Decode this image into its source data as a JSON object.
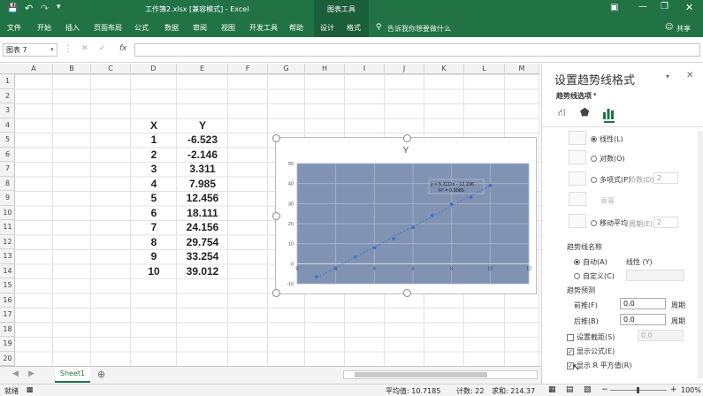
{
  "titlebar": {
    "title": "工作簿2.xlsx [兼容模式] - Excel",
    "context_tools": "图表工具"
  },
  "ribbon": {
    "tabs": [
      "文件",
      "开始",
      "插入",
      "页面布局",
      "公式",
      "数据",
      "审阅",
      "视图",
      "开发工具",
      "帮助",
      "设计",
      "格式"
    ],
    "search_placeholder": "告诉我你想要做什么",
    "share_label": "共享"
  },
  "formula_bar": {
    "name_box": "图表 7",
    "fx_label": "fx",
    "value": ""
  },
  "columns": [
    "A",
    "B",
    "C",
    "D",
    "E",
    "F",
    "G",
    "H",
    "I",
    "J",
    "K",
    "L",
    "M"
  ],
  "rows": [
    "1",
    "2",
    "3",
    "4",
    "5",
    "6",
    "7",
    "8",
    "9",
    "10",
    "11",
    "12",
    "13",
    "14",
    "15",
    "16",
    "17",
    "18",
    "19",
    "20"
  ],
  "table": {
    "x_header": "X",
    "y_header": "Y",
    "x": [
      "1",
      "2",
      "3",
      "4",
      "5",
      "6",
      "7",
      "8",
      "9",
      "10"
    ],
    "y": [
      "-6.523",
      "-2.146",
      "3.311",
      "7.985",
      "12.456",
      "18.111",
      "24.156",
      "29.754",
      "33.254",
      "39.012"
    ]
  },
  "chart_data": {
    "type": "scatter",
    "title": "Y",
    "x": [
      1,
      2,
      3,
      4,
      5,
      6,
      7,
      8,
      9,
      10
    ],
    "series": [
      {
        "name": "Y",
        "values": [
          -6.523,
          -2.146,
          3.311,
          7.985,
          12.456,
          18.111,
          24.156,
          29.754,
          33.254,
          39.012
        ]
      }
    ],
    "trendline": {
      "type": "linear",
      "equation": "y = 5.1111x - 12.196",
      "r2_label": "R² = 0.9985"
    },
    "xlim": [
      0,
      12
    ],
    "ylim": [
      -10,
      50
    ],
    "xticks": [
      "0",
      "2",
      "4",
      "6",
      "8",
      "10",
      "12"
    ],
    "yticks": [
      "-10",
      "0",
      "10",
      "20",
      "30",
      "40",
      "50"
    ],
    "grid": true,
    "plot_bg": "#8093b3",
    "marker_color": "#4472c4"
  },
  "pane": {
    "title": "设置趋势线格式",
    "subtitle": "趋势线选项",
    "options": {
      "linear": "线性(L)",
      "log": "对数(O)",
      "poly": "多项式(P)",
      "poly_order_label": "阶数(D)",
      "poly_order": "2",
      "power": "乘幂",
      "moving_avg": "移动平均",
      "period_label": "周期(E)",
      "period": "2"
    },
    "name_section": "趋势线名称",
    "auto": "自动(A)",
    "auto_value": "线性 (Y)",
    "custom": "自定义(C)",
    "forecast_section": "趋势预测",
    "forward_label": "前推(F)",
    "forward": "0.0",
    "backward_label": "后推(B)",
    "backward": "0.0",
    "period_unit": "周期",
    "intercept_label": "设置截距(S)",
    "intercept": "0.0",
    "show_equation": "显示公式(E)",
    "show_r2": "显示 R 平方值(R)"
  },
  "sheet_tab": "Sheet1",
  "status": {
    "mode": "就绪",
    "average": "平均值: 10.7185",
    "count": "计数: 22",
    "sum": "求和: 214.37",
    "zoom": "100%"
  },
  "colors": {
    "excel_green": "#217346",
    "context_band": "#1b5e3a"
  }
}
